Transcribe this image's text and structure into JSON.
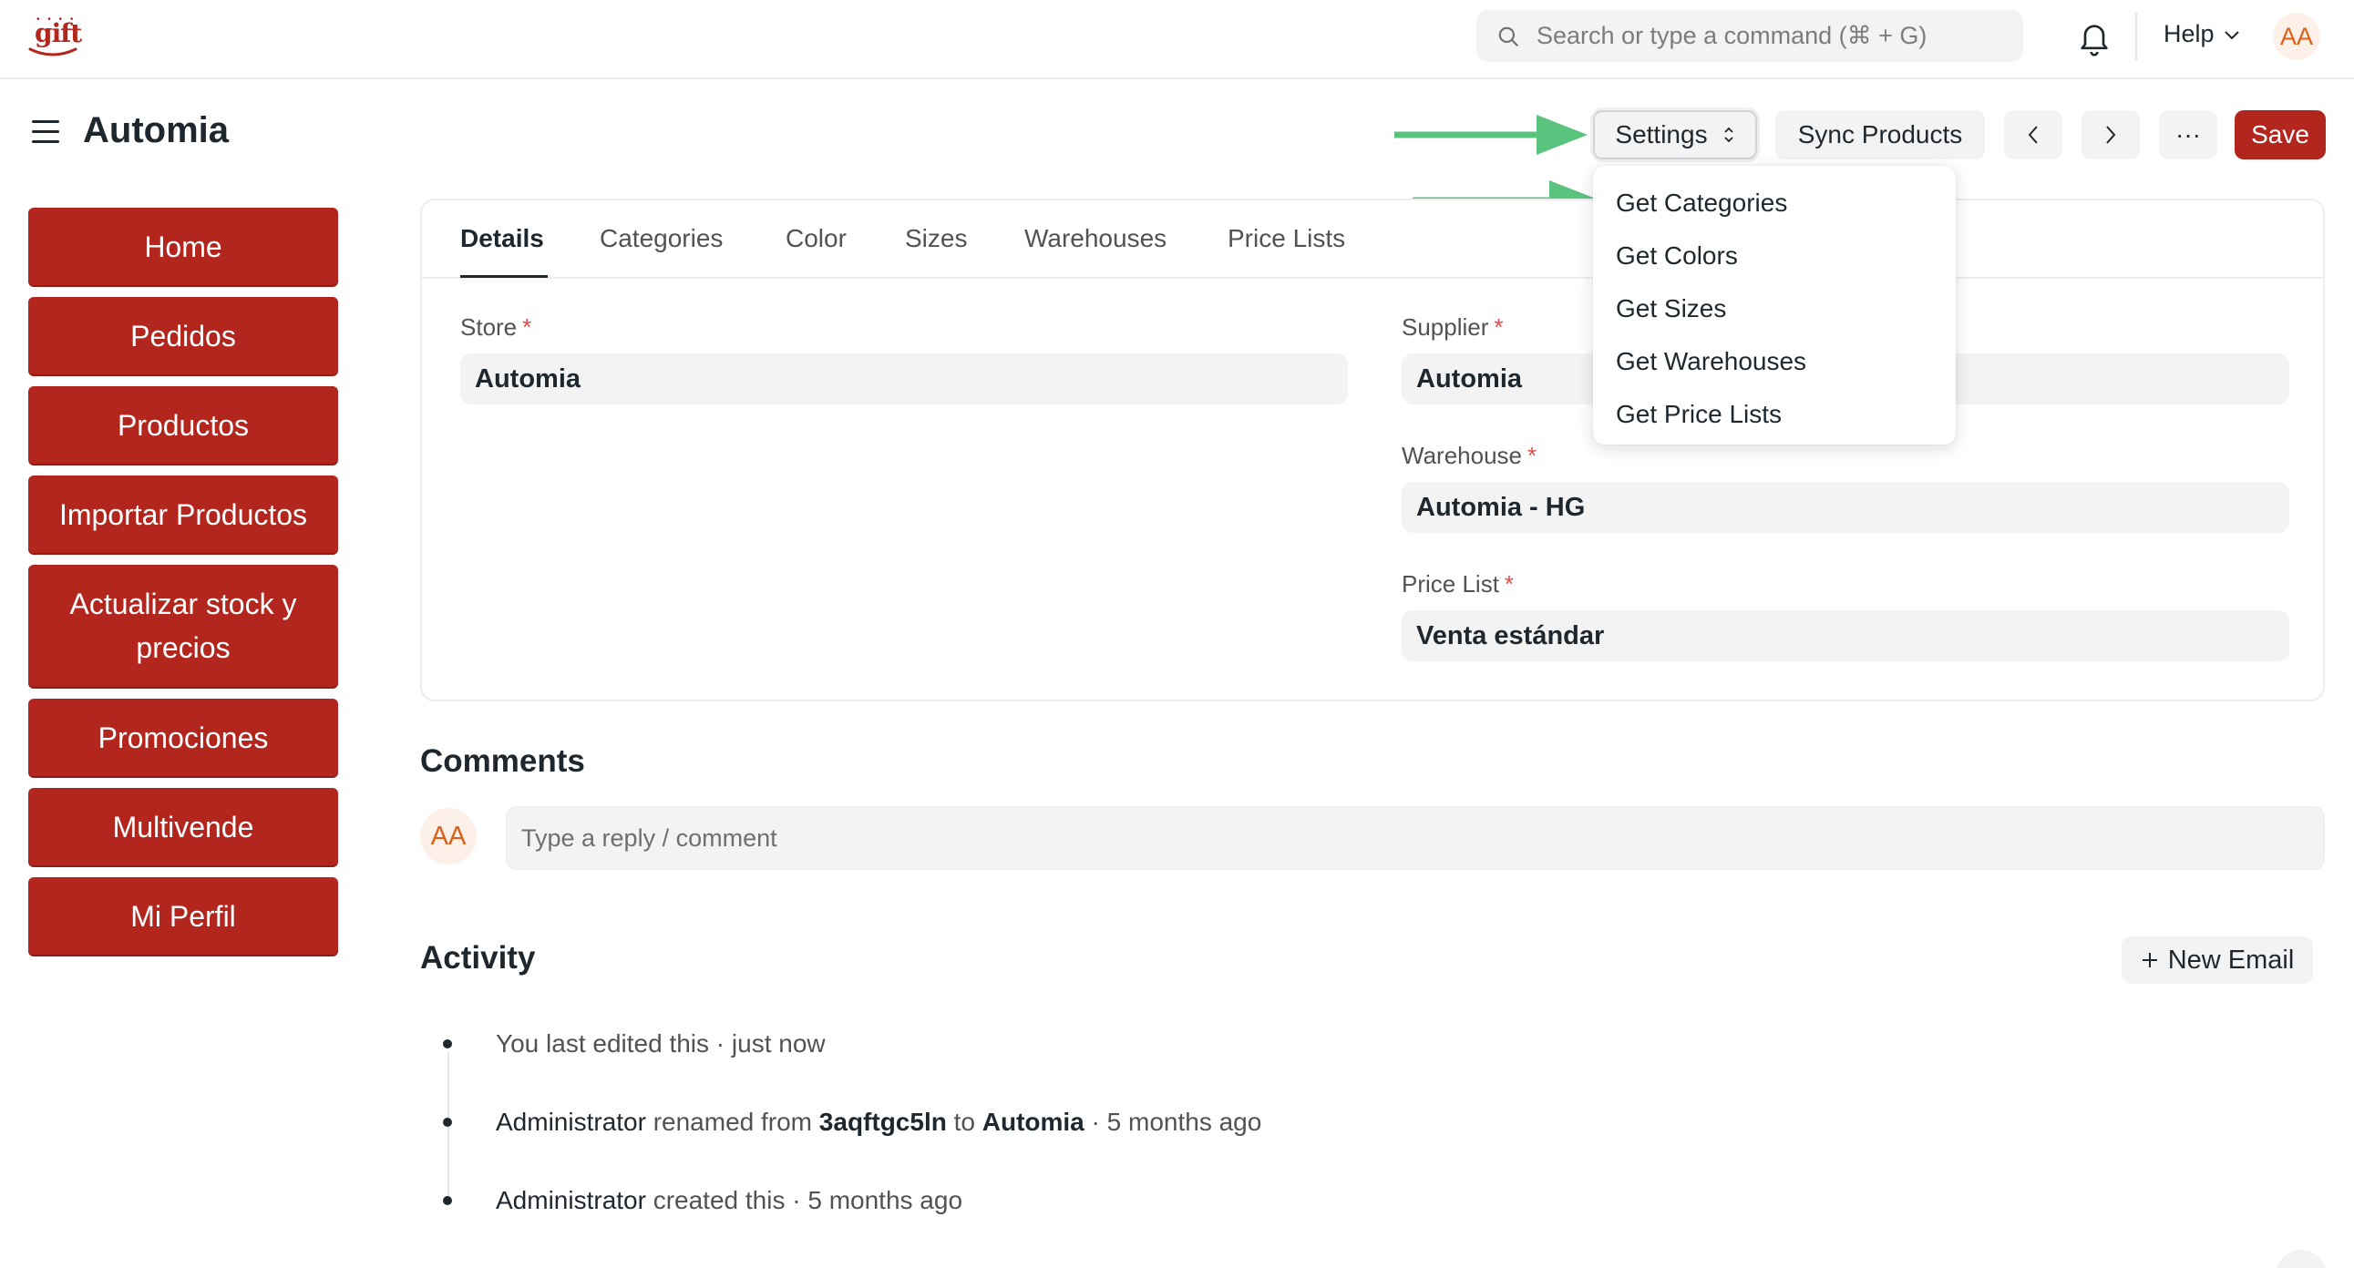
{
  "navbar": {
    "logo_text": "gift",
    "search_placeholder": "Search or type a command (⌘ + G)",
    "help_label": "Help",
    "avatar_initials": "AA"
  },
  "page": {
    "title": "Automia"
  },
  "actions": {
    "settings_label": "Settings",
    "sync_label": "Sync Products",
    "more_label": "···",
    "save_label": "Save"
  },
  "settings_menu": {
    "items": [
      "Get Categories",
      "Get Colors",
      "Get Sizes",
      "Get Warehouses",
      "Get Price Lists"
    ]
  },
  "sidebar": {
    "items": [
      {
        "label": "Home"
      },
      {
        "label": "Pedidos"
      },
      {
        "label": "Productos"
      },
      {
        "label": "Importar Productos"
      },
      {
        "label": "Actualizar stock y precios"
      },
      {
        "label": "Promociones"
      },
      {
        "label": "Multivende"
      },
      {
        "label": "Mi Perfil"
      }
    ]
  },
  "tabs": [
    "Details",
    "Categories",
    "Color",
    "Sizes",
    "Warehouses",
    "Price Lists"
  ],
  "form": {
    "store": {
      "label": "Store",
      "value": "Automia",
      "required_mark": "*"
    },
    "supplier": {
      "label": "Supplier",
      "value": "Automia",
      "required_mark": "*"
    },
    "warehouse": {
      "label": "Warehouse",
      "value": "Automia - HG",
      "required_mark": "*"
    },
    "price_list": {
      "label": "Price List",
      "value": "Venta estándar",
      "required_mark": "*"
    }
  },
  "comments": {
    "title": "Comments",
    "avatar_initials": "AA",
    "placeholder": "Type a reply / comment"
  },
  "activity": {
    "title": "Activity",
    "new_email_label": "New Email",
    "entries": [
      {
        "text_a": "You last edited this",
        "sep": " · ",
        "time": "just now"
      },
      {
        "who": "Administrator",
        "text_a": " renamed from ",
        "from": "3aqftgc5ln",
        "text_b": " to ",
        "to": "Automia",
        "sep": " · ",
        "time": "5 months ago"
      },
      {
        "who": "Administrator",
        "text_a": " created this",
        "sep": " · ",
        "time": "5 months ago"
      }
    ]
  },
  "colors": {
    "brand": "#b3261e",
    "arrow": "#5ac47e",
    "required": "#e24c4c",
    "avatar_bg": "#fdf0e8",
    "avatar_text": "#d9611a"
  }
}
